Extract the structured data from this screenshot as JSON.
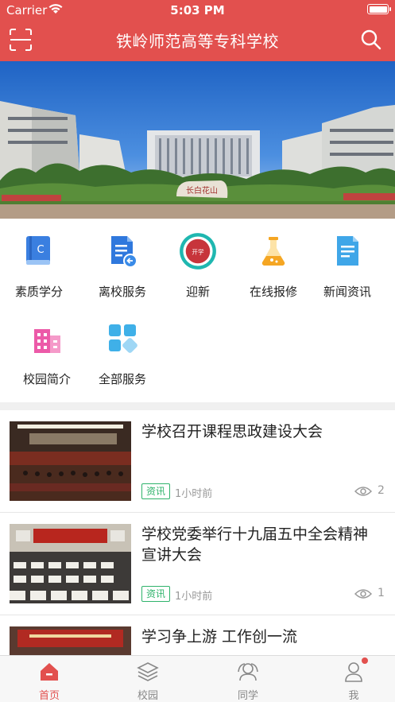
{
  "status": {
    "carrier": "Carrier",
    "time": "5:03 PM"
  },
  "header": {
    "title": "铁岭师范高等专科学校"
  },
  "banner": {
    "stone_text": "长白花山"
  },
  "services": [
    {
      "label": "素质学分",
      "icon": "book-icon"
    },
    {
      "label": "离校服务",
      "icon": "document-return-icon"
    },
    {
      "label": "迎新",
      "icon": "welcome-seal-icon",
      "seal_text": "开学"
    },
    {
      "label": "在线报修",
      "icon": "flask-icon"
    },
    {
      "label": "新闻资讯",
      "icon": "news-document-icon"
    },
    {
      "label": "校园简介",
      "icon": "building-icon"
    },
    {
      "label": "全部服务",
      "icon": "grid-icon"
    }
  ],
  "news": [
    {
      "title": "学校召开课程思政建设大会",
      "tag": "资讯",
      "time": "1小时前",
      "views": "2"
    },
    {
      "title": "学校党委举行十九届五中全会精神宣讲大会",
      "tag": "资讯",
      "time": "1小时前",
      "views": "1"
    },
    {
      "title": "学习争上游 工作创一流",
      "tag": "",
      "time": "",
      "views": ""
    }
  ],
  "tabs": [
    {
      "label": "首页",
      "active": true
    },
    {
      "label": "校园",
      "active": false
    },
    {
      "label": "同学",
      "active": false
    },
    {
      "label": "我",
      "active": false
    }
  ],
  "colors": {
    "brand": "#e2504e",
    "tag_green": "#2fb36b"
  }
}
